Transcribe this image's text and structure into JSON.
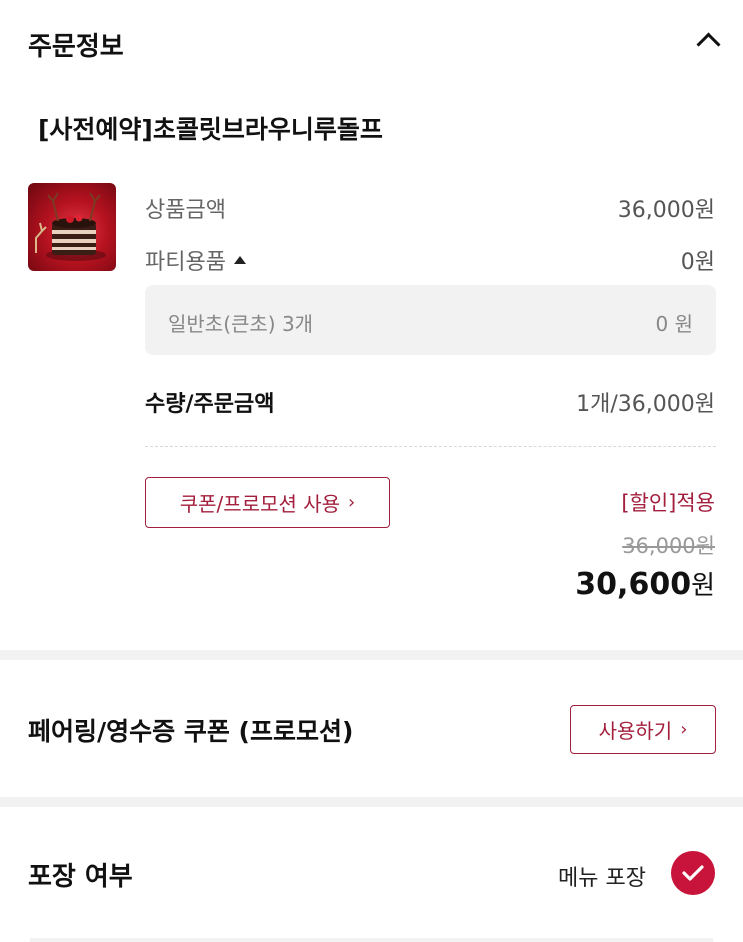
{
  "order_info": {
    "title": "주문정보",
    "product_name": "[사전예약]초콜릿브라우니루돌프",
    "rows": {
      "product_price_label": "상품금액",
      "product_price_value": "36,000원",
      "party_label": "파티용품",
      "party_value": "0원",
      "option_label": "일반초(큰초) 3개",
      "option_value": "0 원",
      "qty_label": "수량/주문금액",
      "qty_value": "1개/36,000원"
    },
    "coupon_button": "쿠폰/프로모션 사용",
    "discount_label": "[할인]적용",
    "original_price": "36,000원",
    "final_price_number": "30,600",
    "final_price_unit": "원"
  },
  "pairing": {
    "title": "페어링/영수증 쿠폰 (프로모션)",
    "button": "사용하기"
  },
  "packaging": {
    "title": "포장 여부",
    "option_label": "메뉴 포장",
    "checked": true
  },
  "colors": {
    "accent": "#a31f3d",
    "check": "#c8143a",
    "band": "#f2f2f2"
  }
}
